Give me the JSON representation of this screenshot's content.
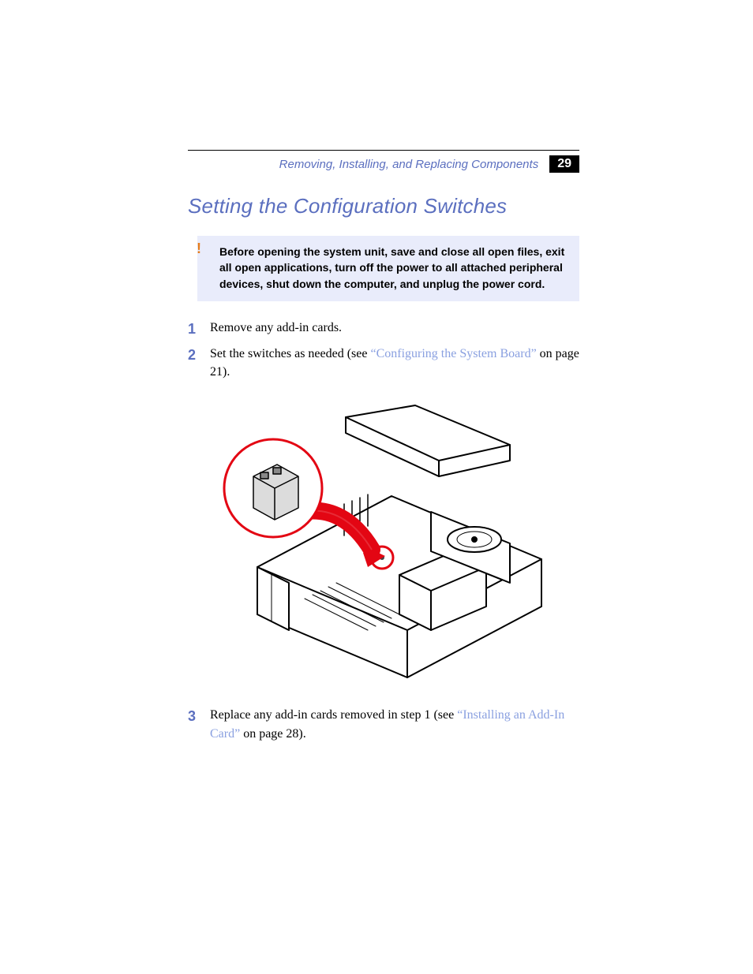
{
  "header": {
    "running_head": "Removing, Installing, and Replacing Components",
    "page_number": "29"
  },
  "section": {
    "title": "Setting the Configuration Switches"
  },
  "caution": {
    "marker": "!",
    "text": "Before opening the system unit, save and close all open files, exit all open applications, turn off the power to all attached peripheral devices, shut down the computer, and unplug the power cord."
  },
  "steps": {
    "s1": {
      "num": "1",
      "text": "Remove any add-in cards."
    },
    "s2": {
      "num": "2",
      "pre": "Set the switches as needed (see ",
      "xref": "“Configuring the System Board”",
      "post": " on page 21)."
    },
    "s3": {
      "num": "3",
      "pre": "Replace any add-in cards removed in step 1 (see ",
      "xref": "“Installing an Add-In Card”",
      "post": " on page 28)."
    }
  },
  "figure": {
    "alt": "Open system unit chassis with motherboard, power supply, and drive. A red circle inset magnifies the configuration switch block, with a red arrow pointing to its location on the board."
  }
}
